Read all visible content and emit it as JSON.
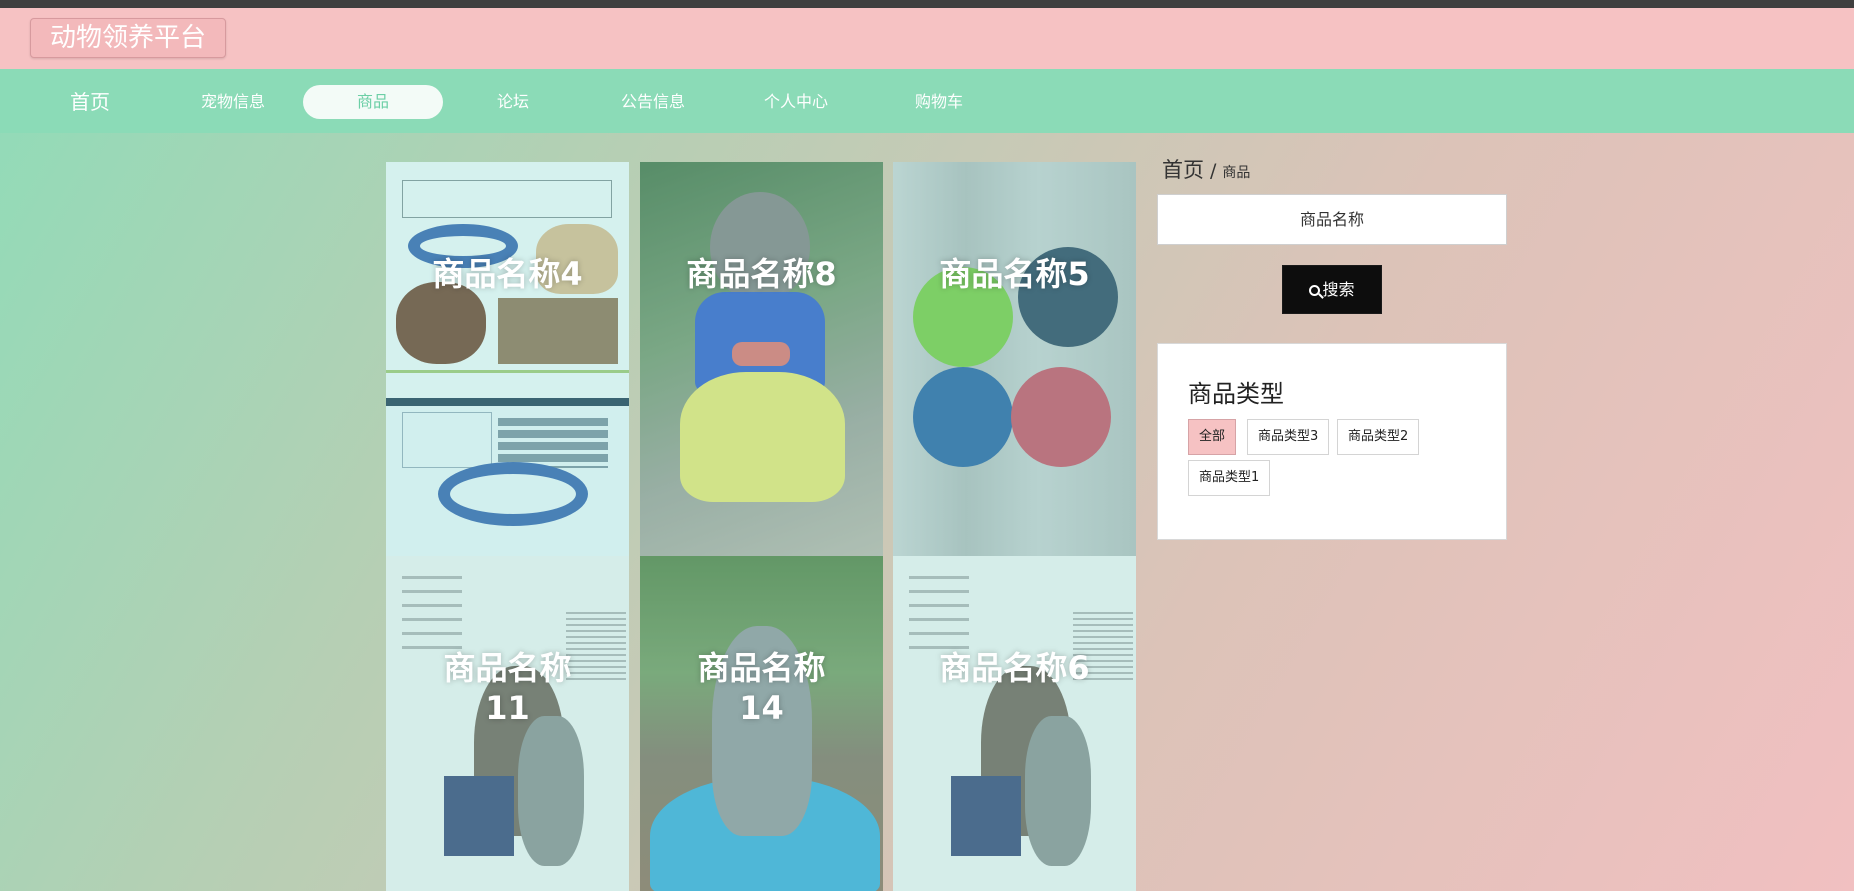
{
  "app": {
    "title": "动物领养平台"
  },
  "nav": {
    "items": [
      {
        "label": "首页"
      },
      {
        "label": "宠物信息"
      },
      {
        "label": "商品",
        "active": true
      },
      {
        "label": "论坛"
      },
      {
        "label": "公告信息"
      },
      {
        "label": "个人中心"
      },
      {
        "label": "购物车"
      }
    ]
  },
  "products": [
    {
      "name": "商品名称4"
    },
    {
      "name": "商品名称8"
    },
    {
      "name": "商品名称5"
    },
    {
      "name": "商品名称11"
    },
    {
      "name": "商品名称14"
    },
    {
      "name": "商品名称6"
    }
  ],
  "breadcrumb": {
    "home": "首页",
    "separator": "/",
    "current": "商品"
  },
  "search": {
    "placeholder": "商品名称",
    "button_label": "搜索",
    "icon": "search-icon"
  },
  "categories": {
    "title": "商品类型",
    "items": [
      {
        "label": "全部",
        "active": true
      },
      {
        "label": "商品类型3"
      },
      {
        "label": "商品类型2"
      },
      {
        "label": "商品类型1"
      }
    ]
  },
  "colors": {
    "header_bg": "#f6c2c3",
    "nav_bg": "#8bdbb7",
    "active_tag_bg": "#f6c2c3",
    "search_button_bg": "#0d0d0d"
  }
}
